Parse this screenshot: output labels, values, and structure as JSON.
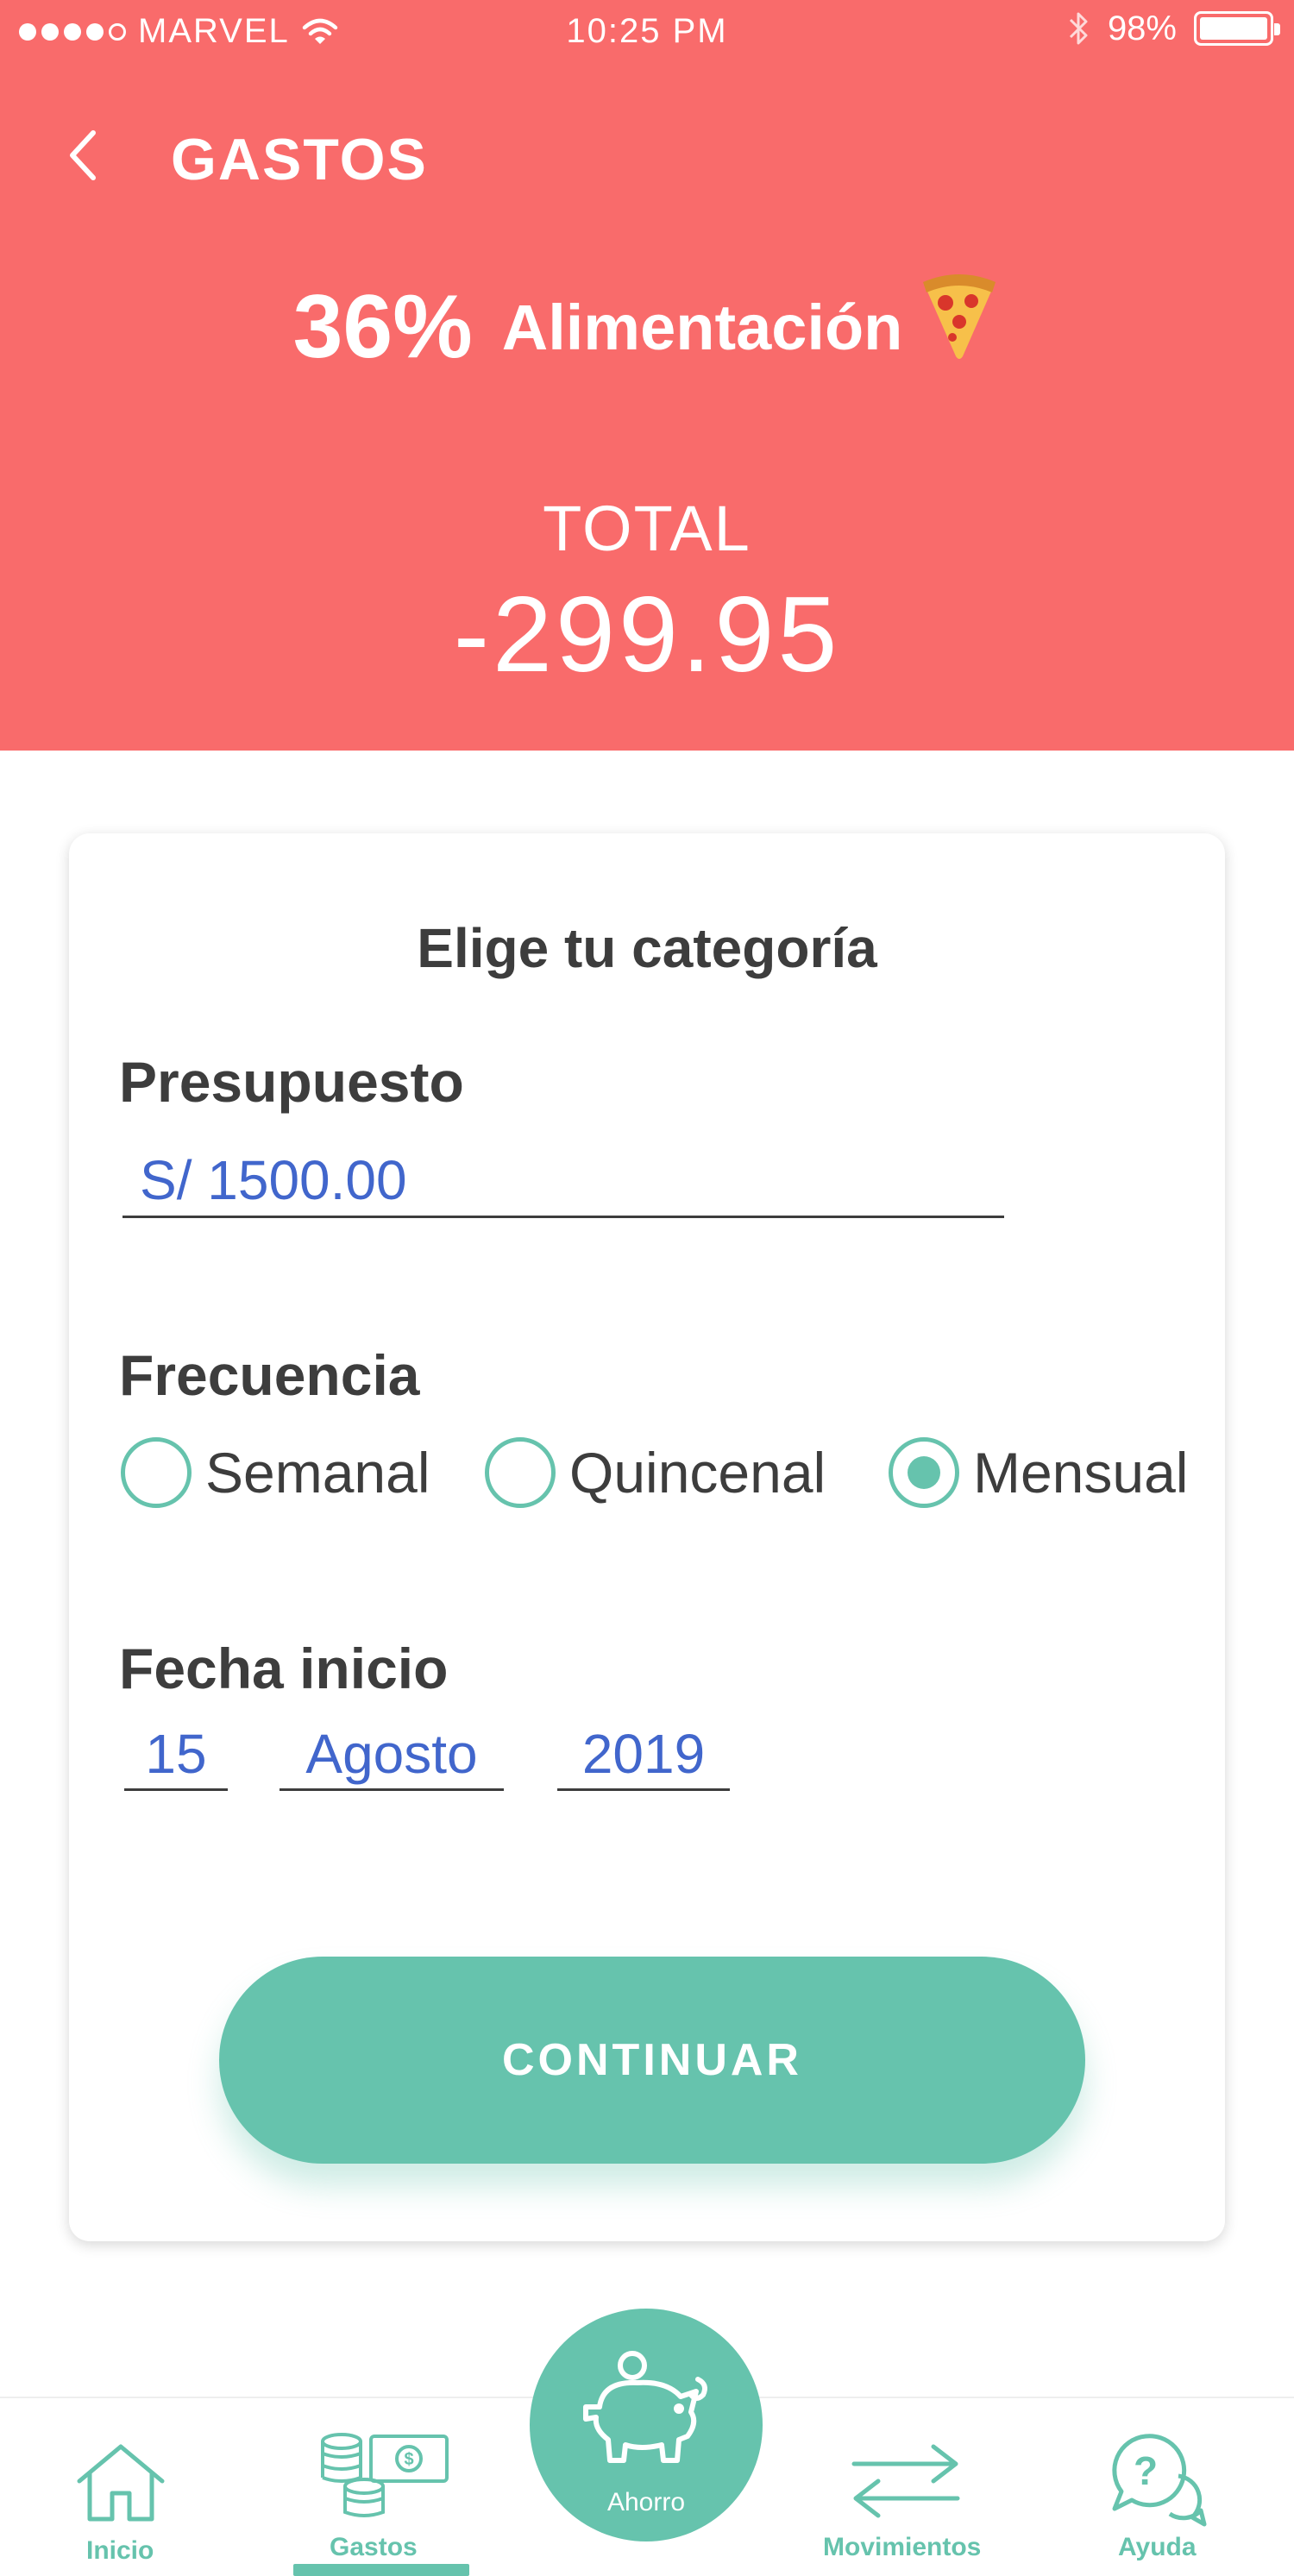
{
  "status_bar": {
    "carrier": "MARVEL",
    "time": "10:25 PM",
    "battery": "98%",
    "signal_dots_filled": 4,
    "signal_dots_total": 5
  },
  "header": {
    "title": "GASTOS",
    "percent": "36%",
    "category": "Alimentación",
    "category_icon": "pizza-icon",
    "total_label": "TOTAL",
    "total_value": "-299.95",
    "background_color": "#f96b6b"
  },
  "form": {
    "title": "Elige tu categoría",
    "budget_label": "Presupuesto",
    "budget_value": "S/ 1500.00",
    "frequency_label": "Frecuencia",
    "frequency_options": [
      {
        "label": "Semanal",
        "selected": false
      },
      {
        "label": "Quincenal",
        "selected": false
      },
      {
        "label": "Mensual",
        "selected": true
      }
    ],
    "start_date_label": "Fecha inicio",
    "start_date": {
      "day": "15",
      "month": "Agosto",
      "year": "2019"
    },
    "continue_label": "CONTINUAR"
  },
  "tabbar": {
    "tabs": [
      {
        "label": "Inicio",
        "icon": "home-icon",
        "active": false
      },
      {
        "label": "Gastos",
        "icon": "money-icon",
        "active": true
      },
      {
        "label": "Ahorro",
        "icon": "piggy-bank-icon",
        "active": false
      },
      {
        "label": "Movimientos",
        "icon": "transfer-arrows-icon",
        "active": false
      },
      {
        "label": "Ayuda",
        "icon": "help-chat-icon",
        "active": false
      }
    ]
  },
  "colors": {
    "accent": "#66c3ad",
    "header": "#f96b6b",
    "input_text": "#4166cc",
    "text": "#3d3d3d"
  }
}
